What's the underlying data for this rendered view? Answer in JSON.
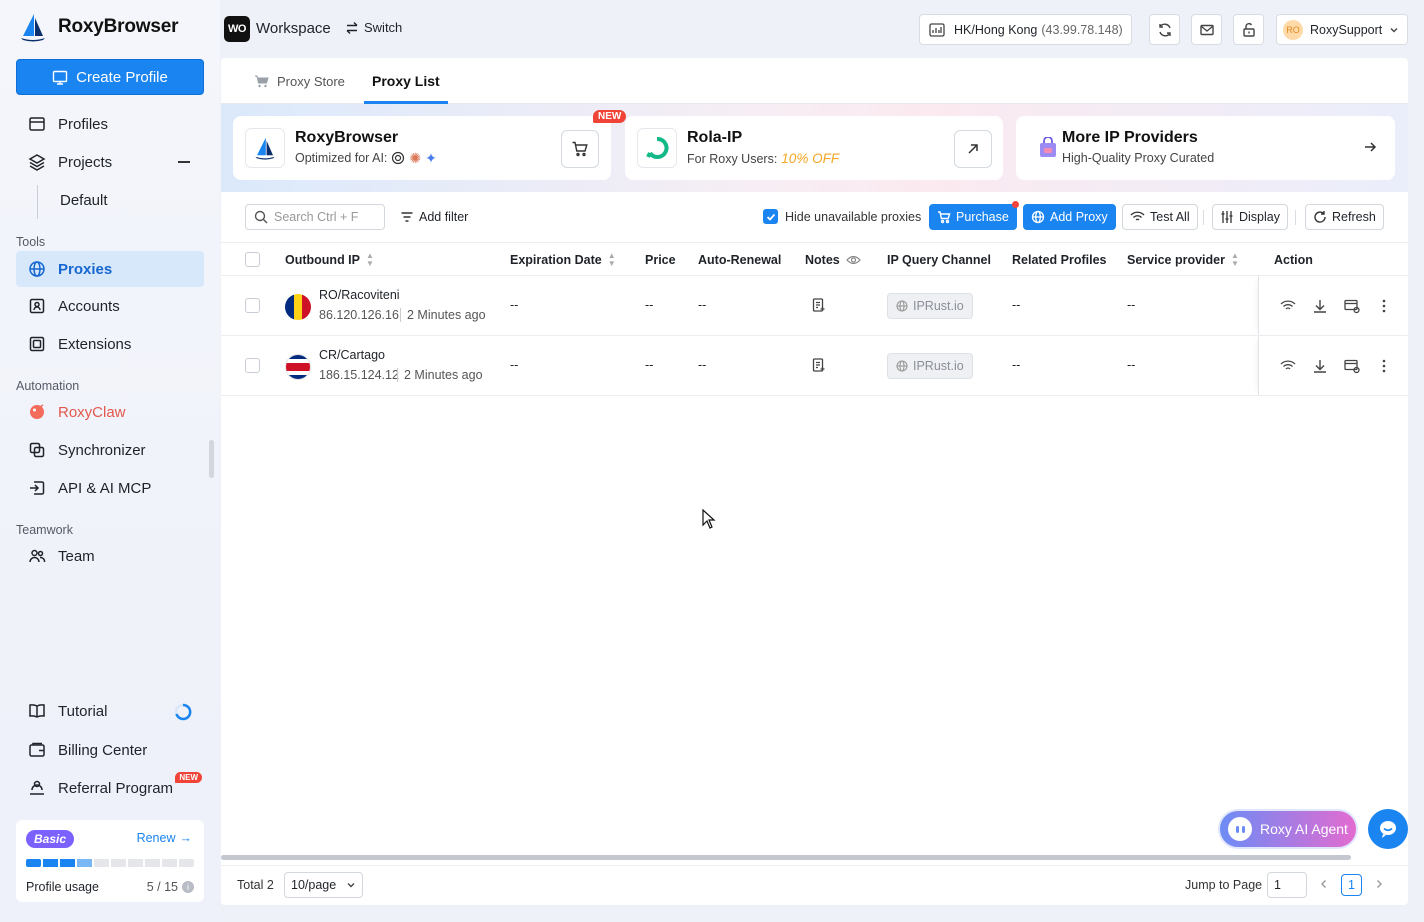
{
  "brand": {
    "name": "RoxyBrowser"
  },
  "workspace": {
    "badge": "WO",
    "label": "Workspace",
    "switch_label": "Switch"
  },
  "topbar": {
    "location": "HK/Hong Kong",
    "ip": "(43.99.78.148)",
    "user_initials": "RO",
    "user_name": "RoxySupport"
  },
  "sidebar": {
    "create_label": "Create Profile",
    "profiles": "Profiles",
    "projects": "Projects",
    "default_project": "Default",
    "tools_label": "Tools",
    "proxies": "Proxies",
    "accounts": "Accounts",
    "extensions": "Extensions",
    "automation_label": "Automation",
    "roxyclaw": "RoxyClaw",
    "synchronizer": "Synchronizer",
    "api": "API & AI MCP",
    "teamwork_label": "Teamwork",
    "team": "Team",
    "tutorial": "Tutorial",
    "billing": "Billing Center",
    "referral": "Referral Program",
    "referral_badge": "NEW",
    "plan": "Basic",
    "renew": "Renew",
    "usage_label": "Profile usage",
    "usage_value": "5 / 15",
    "usage_fraction": 0.3333
  },
  "tabs": {
    "store": "Proxy Store",
    "list": "Proxy List"
  },
  "cards": [
    {
      "title": "RoxyBrowser",
      "sub": "Optimized for AI:",
      "badge": "NEW"
    },
    {
      "title": "Rola-IP",
      "sub": "For Roxy Users:",
      "highlight": "10% OFF"
    },
    {
      "title": "More IP Providers",
      "sub": "High-Quality Proxy Curated"
    }
  ],
  "toolbar": {
    "search_placeholder": "Search Ctrl + F",
    "add_filter": "Add filter",
    "hide_unavailable": "Hide unavailable proxies",
    "purchase": "Purchase",
    "add_proxy": "Add Proxy",
    "test_all": "Test All",
    "display": "Display",
    "refresh": "Refresh"
  },
  "table": {
    "columns": [
      "Outbound IP",
      "Expiration Date",
      "Price",
      "Auto-Renewal",
      "Notes",
      "IP Query Channel",
      "Related Profiles",
      "Service provider",
      "Action"
    ],
    "rows": [
      {
        "location": "RO/Racoviteni",
        "ip": "86.120.126.16",
        "time": "2 Minutes ago",
        "expiration": "--",
        "price": "--",
        "renewal": "--",
        "channel": "IPRust.io",
        "related": "--",
        "provider": "--"
      },
      {
        "location": "CR/Cartago",
        "ip": "186.15.124.12",
        "time": "2 Minutes ago",
        "expiration": "--",
        "price": "--",
        "renewal": "--",
        "channel": "IPRust.io",
        "related": "--",
        "provider": "--"
      }
    ]
  },
  "footer": {
    "total": "Total 2",
    "per_page": "10/page",
    "jump_label": "Jump to Page",
    "jump_value": "1",
    "current_page": "1"
  },
  "assistant": {
    "agent_label": "Roxy AI Agent"
  },
  "colors": {
    "accent": "#1a84f0",
    "active_bg": "#d7e8fb",
    "badge_red": "#f04438",
    "plan_purple": "#7b61ff",
    "discount": "#f5a623"
  }
}
